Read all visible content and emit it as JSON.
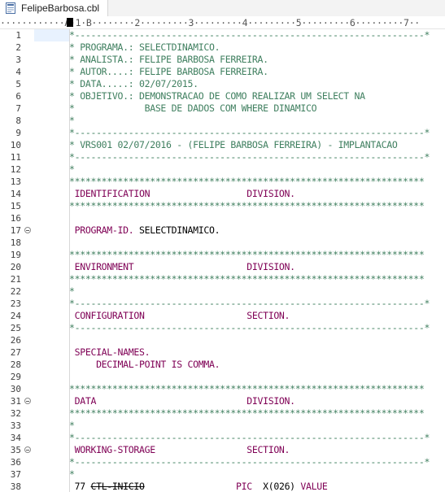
{
  "tab": {
    "title": "FelipeBarbosa.cbl",
    "icon": "cobol-file-icon"
  },
  "ruler": {
    "text": "············A·1·B········2·········3·········4·········5·········6·········7··"
  },
  "lines": [
    {
      "n": "1",
      "fold": false,
      "segs": [
        {
          "t": "*-----------------------------------------------------------------*",
          "c": "comment"
        }
      ]
    },
    {
      "n": "2",
      "fold": false,
      "segs": [
        {
          "t": "* PROGRAMA.: SELECTDINAMICO.",
          "c": "comment"
        }
      ]
    },
    {
      "n": "3",
      "fold": false,
      "segs": [
        {
          "t": "* ANALISTA.: FELIPE BARBOSA FERREIRA.",
          "c": "comment"
        }
      ]
    },
    {
      "n": "4",
      "fold": false,
      "segs": [
        {
          "t": "* AUTOR....: FELIPE BARBOSA FERREIRA.",
          "c": "comment"
        }
      ]
    },
    {
      "n": "5",
      "fold": false,
      "segs": [
        {
          "t": "* DATA.....: 02/07/2015.",
          "c": "comment"
        }
      ]
    },
    {
      "n": "6",
      "fold": false,
      "segs": [
        {
          "t": "* OBJETIVO.: DEMONSTRACAO DE COMO REALIZAR UM SELECT NA",
          "c": "comment"
        }
      ]
    },
    {
      "n": "7",
      "fold": false,
      "segs": [
        {
          "t": "*             BASE DE DADOS COM WHERE DINAMICO",
          "c": "comment"
        }
      ]
    },
    {
      "n": "8",
      "fold": false,
      "segs": [
        {
          "t": "*",
          "c": "comment"
        }
      ]
    },
    {
      "n": "9",
      "fold": false,
      "segs": [
        {
          "t": "*-----------------------------------------------------------------*",
          "c": "comment"
        }
      ]
    },
    {
      "n": "10",
      "fold": false,
      "segs": [
        {
          "t": "* VRS001 02/07/2016 - (FELIPE BARBOSA FERREIRA) - IMPLANTACAO",
          "c": "comment"
        }
      ]
    },
    {
      "n": "11",
      "fold": false,
      "segs": [
        {
          "t": "*-----------------------------------------------------------------*",
          "c": "comment"
        }
      ]
    },
    {
      "n": "12",
      "fold": false,
      "segs": [
        {
          "t": "*",
          "c": "comment"
        }
      ]
    },
    {
      "n": "13",
      "fold": false,
      "segs": [
        {
          "t": "******************************************************************",
          "c": "comment"
        }
      ]
    },
    {
      "n": "14",
      "fold": false,
      "segs": [
        {
          "t": " IDENTIFICATION                  DIVISION.",
          "c": "kw"
        }
      ]
    },
    {
      "n": "15",
      "fold": false,
      "segs": [
        {
          "t": "******************************************************************",
          "c": "comment"
        }
      ]
    },
    {
      "n": "16",
      "fold": false,
      "segs": []
    },
    {
      "n": "17",
      "fold": true,
      "segs": [
        {
          "t": " PROGRAM-ID.",
          "c": "kw"
        },
        {
          "t": " SELECTDINAMICO.",
          "c": "normal"
        }
      ]
    },
    {
      "n": "18",
      "fold": false,
      "segs": []
    },
    {
      "n": "19",
      "fold": false,
      "segs": [
        {
          "t": "******************************************************************",
          "c": "comment"
        }
      ]
    },
    {
      "n": "20",
      "fold": false,
      "segs": [
        {
          "t": " ENVIRONMENT                     DIVISION.",
          "c": "kw"
        }
      ]
    },
    {
      "n": "21",
      "fold": false,
      "segs": [
        {
          "t": "******************************************************************",
          "c": "comment"
        }
      ]
    },
    {
      "n": "22",
      "fold": false,
      "segs": [
        {
          "t": "*",
          "c": "comment"
        }
      ]
    },
    {
      "n": "23",
      "fold": false,
      "segs": [
        {
          "t": "*-----------------------------------------------------------------*",
          "c": "comment"
        }
      ]
    },
    {
      "n": "24",
      "fold": false,
      "segs": [
        {
          "t": " CONFIGURATION                   SECTION.",
          "c": "kw"
        }
      ]
    },
    {
      "n": "25",
      "fold": false,
      "segs": [
        {
          "t": "*-----------------------------------------------------------------*",
          "c": "comment"
        }
      ]
    },
    {
      "n": "26",
      "fold": false,
      "segs": []
    },
    {
      "n": "27",
      "fold": false,
      "segs": [
        {
          "t": " SPECIAL-NAMES.",
          "c": "kw"
        }
      ]
    },
    {
      "n": "28",
      "fold": false,
      "segs": [
        {
          "t": "     DECIMAL-POINT IS COMMA.",
          "c": "kw"
        }
      ]
    },
    {
      "n": "29",
      "fold": false,
      "segs": []
    },
    {
      "n": "30",
      "fold": false,
      "segs": [
        {
          "t": "******************************************************************",
          "c": "comment"
        }
      ]
    },
    {
      "n": "31",
      "fold": true,
      "segs": [
        {
          "t": " DATA                            DIVISION.",
          "c": "kw"
        }
      ]
    },
    {
      "n": "32",
      "fold": false,
      "segs": [
        {
          "t": "******************************************************************",
          "c": "comment"
        }
      ]
    },
    {
      "n": "33",
      "fold": false,
      "segs": [
        {
          "t": "*",
          "c": "comment"
        }
      ]
    },
    {
      "n": "34",
      "fold": false,
      "segs": [
        {
          "t": "*-----------------------------------------------------------------*",
          "c": "comment"
        }
      ]
    },
    {
      "n": "35",
      "fold": true,
      "segs": [
        {
          "t": " WORKING-STORAGE                 SECTION.",
          "c": "kw"
        }
      ]
    },
    {
      "n": "36",
      "fold": false,
      "segs": [
        {
          "t": "*-----------------------------------------------------------------*",
          "c": "comment"
        }
      ]
    },
    {
      "n": "37",
      "fold": false,
      "segs": [
        {
          "t": "*",
          "c": "comment"
        }
      ]
    },
    {
      "n": "38",
      "fold": false,
      "segs": [
        {
          "t": " 77 ",
          "c": "normal"
        },
        {
          "t": "CTL-INICIO",
          "c": "normal",
          "strike": true
        },
        {
          "t": "                 ",
          "c": "normal"
        },
        {
          "t": "PIC",
          "c": "kw"
        },
        {
          "t": "  X(026) ",
          "c": "normal"
        },
        {
          "t": "VALUE",
          "c": "kw"
        }
      ]
    }
  ]
}
